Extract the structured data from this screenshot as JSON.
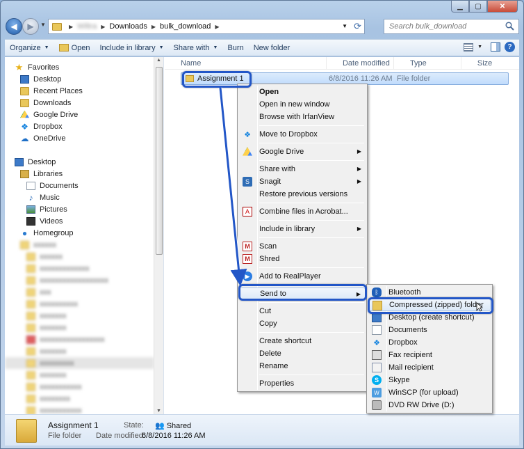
{
  "window": {
    "caption_min": "▁",
    "caption_max": "▢",
    "caption_close": "✕"
  },
  "address": {
    "crumbs": [
      "Downloads",
      "bulk_download"
    ],
    "blurred_crumb": "Wiltra",
    "search_placeholder": "Search bulk_download"
  },
  "toolbar": {
    "organize": "Organize",
    "open": "Open",
    "include_in_library": "Include in library",
    "share_with": "Share with",
    "burn": "Burn",
    "new_folder": "New folder"
  },
  "nav": {
    "favorites": "Favorites",
    "desktop": "Desktop",
    "recent_places": "Recent Places",
    "downloads": "Downloads",
    "google_drive": "Google Drive",
    "dropbox": "Dropbox",
    "onedrive": "OneDrive",
    "desktop2": "Desktop",
    "libraries": "Libraries",
    "documents": "Documents",
    "music": "Music",
    "pictures": "Pictures",
    "videos": "Videos",
    "homegroup": "Homegroup"
  },
  "columns": {
    "name": "Name",
    "date_modified": "Date modified",
    "type": "Type",
    "size": "Size"
  },
  "file_row": {
    "name": "Assignment 1",
    "date": "6/8/2016 11:26 AM",
    "type": "File folder"
  },
  "context_menu": {
    "open": "Open",
    "open_new_window": "Open in new window",
    "browse_irfanview": "Browse with IrfanView",
    "move_to_dropbox": "Move to Dropbox",
    "google_drive": "Google Drive",
    "share_with": "Share with",
    "snagit": "Snagit",
    "restore_previous": "Restore previous versions",
    "combine_acrobat": "Combine files in Acrobat...",
    "include_in_library": "Include in library",
    "scan": "Scan",
    "shred": "Shred",
    "add_to_realplayer": "Add to RealPlayer",
    "send_to": "Send to",
    "cut": "Cut",
    "copy": "Copy",
    "create_shortcut": "Create shortcut",
    "delete": "Delete",
    "rename": "Rename",
    "properties": "Properties"
  },
  "send_to_menu": {
    "bluetooth": "Bluetooth",
    "compressed": "Compressed (zipped) folder",
    "desktop_shortcut": "Desktop (create shortcut)",
    "documents": "Documents",
    "dropbox": "Dropbox",
    "fax": "Fax recipient",
    "mail": "Mail recipient",
    "skype": "Skype",
    "winscp": "WinSCP (for upload)",
    "dvd": "DVD RW Drive (D:)"
  },
  "details": {
    "name": "Assignment 1",
    "type": "File folder",
    "state_label": "State:",
    "state_value": "Shared",
    "modified_label": "Date modified:",
    "modified_value": "6/8/2016 11:26 AM"
  },
  "colors": {
    "annotation": "#2256c7",
    "selection": "#c1dcfc"
  }
}
